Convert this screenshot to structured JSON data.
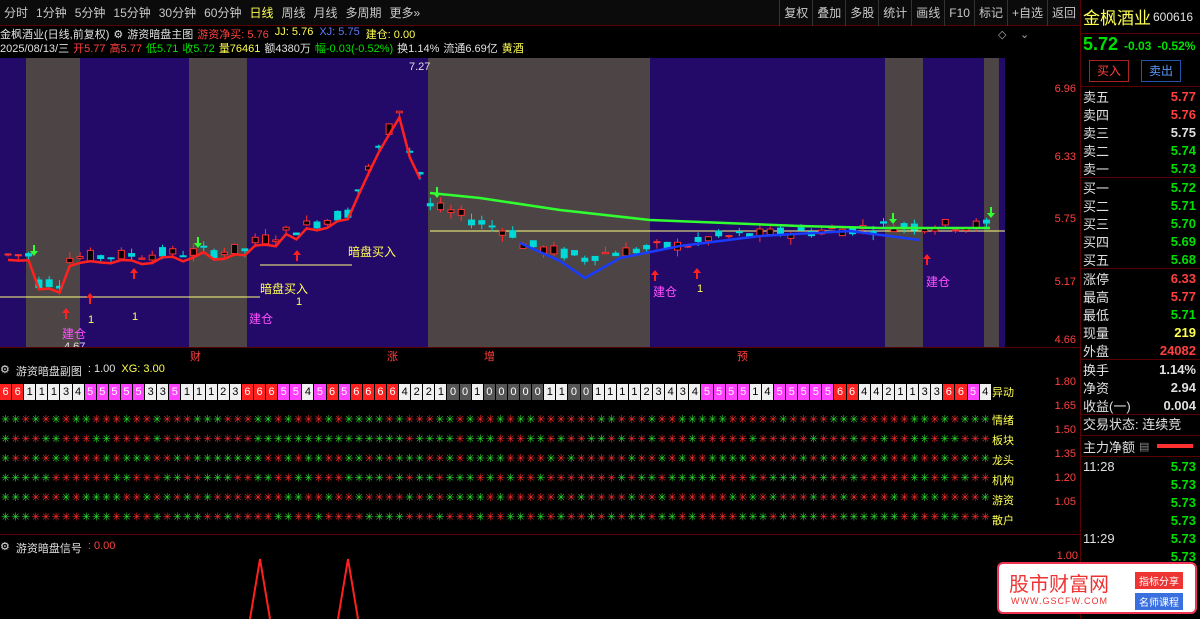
{
  "toolbar": {
    "left": [
      "分时",
      "1分钟",
      "5分钟",
      "15分钟",
      "30分钟",
      "60分钟",
      "日线",
      "周线",
      "月线",
      "多周期",
      "更多»"
    ],
    "active": "日线",
    "right": [
      "复权",
      "叠加",
      "多股",
      "统计",
      "画线",
      "F10",
      "标记",
      "+自选",
      "返回"
    ]
  },
  "info": {
    "line1_name": "金枫酒业(日线,前复权)",
    "line1_indicator": "游资暗盘主图",
    "line1_parts": [
      {
        "t": "游资净买: 5.76",
        "c": "c-red"
      },
      {
        "t": "JJ: 5.76",
        "c": "c-yellow"
      },
      {
        "t": "XJ: 5.75",
        "c": "c-blue"
      },
      {
        "t": "建仓: 0.00",
        "c": "c-yellow"
      }
    ],
    "line2_parts": [
      {
        "t": "2025/08/13/三",
        "c": "c-white"
      },
      {
        "t": "开5.77",
        "c": "c-red"
      },
      {
        "t": "高5.77",
        "c": "c-red"
      },
      {
        "t": "低5.71",
        "c": "c-green"
      },
      {
        "t": "收5.72",
        "c": "c-green"
      },
      {
        "t": "量76461",
        "c": "c-yellow"
      },
      {
        "t": "额4380万",
        "c": "c-white"
      },
      {
        "t": "幅-0.03(-0.52%)",
        "c": "c-green"
      },
      {
        "t": "换1.14%",
        "c": "c-white"
      },
      {
        "t": "流通6.69亿",
        "c": "c-white"
      },
      {
        "t": "黄酒",
        "c": "c-yellow"
      }
    ]
  },
  "main_axis": [
    "6.96",
    "6.33",
    "5.75",
    "5.17",
    "4.66"
  ],
  "chart_labels": {
    "high": "7.27",
    "low": "4.67",
    "buy1": "暗盘买入",
    "buy2": "暗盘买入",
    "jiancang": "建仓",
    "one": "1",
    "bottom_tags": [
      "财",
      "涨",
      "增",
      "预"
    ]
  },
  "sub1": {
    "title": "游资暗盘副图",
    "value": ": 1.00",
    "xg": "XG: 3.00",
    "axis": [
      "1.80",
      "1.65",
      "1.50",
      "1.35",
      "1.20",
      "1.05"
    ],
    "row_labels": [
      "异动",
      "情绪",
      "板块",
      "龙头",
      "机构",
      "游资",
      "散户"
    ],
    "digits": "6611134555553351112366655456566664221001000001100111123434555514555556644211336654"
  },
  "sub2": {
    "title": "游资暗盘信号",
    "value": ": 0.00",
    "axis": [
      "1.00"
    ]
  },
  "right_panel": {
    "name": "金枫酒业",
    "code": "600616",
    "price": "5.72",
    "change": "-0.03",
    "change_pct": "-0.52%",
    "buy_btn": "买入",
    "sell_btn": "卖出",
    "asks": [
      {
        "l": "卖五",
        "v": "5.77",
        "c": "#ff4040"
      },
      {
        "l": "卖四",
        "v": "5.76",
        "c": "#ff4040"
      },
      {
        "l": "卖三",
        "v": "5.75",
        "c": "#e0e0e0"
      },
      {
        "l": "卖二",
        "v": "5.74",
        "c": "#00e000"
      },
      {
        "l": "卖一",
        "v": "5.73",
        "c": "#00e000"
      }
    ],
    "bids": [
      {
        "l": "买一",
        "v": "5.72",
        "c": "#00e000"
      },
      {
        "l": "买二",
        "v": "5.71",
        "c": "#00e000"
      },
      {
        "l": "买三",
        "v": "5.70",
        "c": "#00e000"
      },
      {
        "l": "买四",
        "v": "5.69",
        "c": "#00e000"
      },
      {
        "l": "买五",
        "v": "5.68",
        "c": "#00e000"
      }
    ],
    "stats": [
      {
        "l": "涨停",
        "v": "6.33",
        "c": "#ff4040"
      },
      {
        "l": "最高",
        "v": "5.77",
        "c": "#ff4040"
      },
      {
        "l": "最低",
        "v": "5.71",
        "c": "#00e000"
      },
      {
        "l": "现量",
        "v": "219",
        "c": "#ffff54"
      },
      {
        "l": "外盘",
        "v": "24082",
        "c": "#ff4040"
      }
    ],
    "stats2": [
      {
        "l": "换手",
        "v": "1.14%",
        "c": "#e0e0e0"
      },
      {
        "l": "净资",
        "v": "2.94",
        "c": "#e0e0e0"
      },
      {
        "l": "收益(一)",
        "v": "0.004",
        "c": "#e0e0e0"
      }
    ],
    "status": "交易状态: 连续竞",
    "main_flow": "主力净额",
    "ticks": [
      {
        "t": "11:28",
        "v": "5.73"
      },
      {
        "t": "",
        "v": "5.73"
      },
      {
        "t": "",
        "v": "5.73"
      },
      {
        "t": "",
        "v": "5.73"
      },
      {
        "t": "11:29",
        "v": "5.73"
      },
      {
        "t": "",
        "v": "5.73"
      }
    ]
  },
  "watermark": {
    "title": "股市财富网",
    "url": "WWW.GSCFW.COM",
    "tag1": "指标分享",
    "tag2": "名师课程"
  }
}
